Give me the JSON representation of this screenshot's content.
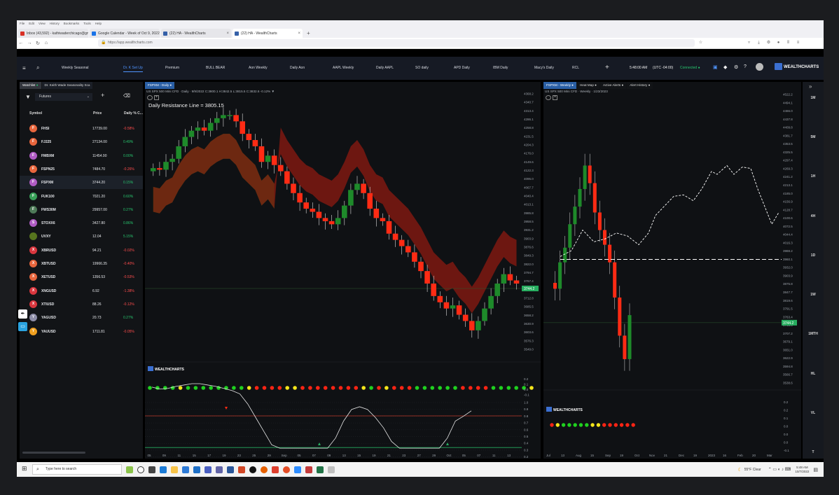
{
  "browser": {
    "menu": [
      "File",
      "Edit",
      "View",
      "History",
      "Bookmarks",
      "Tools",
      "Help"
    ],
    "tabs": [
      {
        "label": "Inbox (43,592) - kathiwaderchicago@gmail.com",
        "fav": "#d93025",
        "active": false
      },
      {
        "label": "Google Calendar - Week of Oct 9, 2022",
        "fav": "#1a73e8",
        "active": false
      },
      {
        "label": "(22) HA - WealthCharts",
        "fav": "#3560a8",
        "active": false
      },
      {
        "label": "(22) HA - WealthCharts",
        "fav": "#3560a8",
        "active": true
      }
    ],
    "url": "https://app.wealthcharts.com"
  },
  "toolbar": {
    "tabs": [
      {
        "label": "Weekly Seasonal",
        "x": 64
      },
      {
        "label": "Dr. K Set Up",
        "x": 152,
        "selected": true
      },
      {
        "label": "Premium",
        "x": 212
      },
      {
        "label": "BULL BEAR",
        "x": 270
      },
      {
        "label": "Aon Weekly",
        "x": 331
      },
      {
        "label": "Daily Aon",
        "x": 390
      },
      {
        "label": "AAPL Weekly",
        "x": 451
      },
      {
        "label": "Daily AAPL",
        "x": 513
      },
      {
        "label": "SO daily",
        "x": 569
      },
      {
        "label": "APD Daily",
        "x": 624
      },
      {
        "label": "IBM Daily",
        "x": 680
      },
      {
        "label": "Macy's Daily",
        "x": 739
      },
      {
        "label": "RCL",
        "x": 793
      }
    ],
    "time": "5:48:00 AM",
    "tz": "(UTC -04:00)",
    "status": "Connected",
    "brand": "WEALTHCHARTS"
  },
  "watchlist": {
    "tabs": [
      "Watchlist",
      "Dr. Keith Wade Seasonality Sca"
    ],
    "list": "Futures",
    "headers": {
      "symbol": "Symbol",
      "price": "Price",
      "change": "Daily % C..."
    },
    "rows": [
      {
        "letter": "F",
        "color": "#e8663d",
        "symbol": "FHSI",
        "price": "17739.00",
        "change": "-0.58%",
        "dir": "dn"
      },
      {
        "letter": "F",
        "color": "#e8663d",
        "symbol": "FJ225",
        "price": "27134.00",
        "change": "0.49%",
        "dir": "up"
      },
      {
        "letter": "F",
        "color": "#b05cc4",
        "symbol": "FMBXM",
        "price": "11454.90",
        "change": "0.00%",
        "dir": "up"
      },
      {
        "letter": "F",
        "color": "#e8663d",
        "symbol": "FSPN25",
        "price": "7484.70",
        "change": "-0.26%",
        "dir": "dn"
      },
      {
        "letter": "F",
        "color": "#b05cc4",
        "symbol": "FSPXM",
        "price": "3744.20",
        "change": "0.15%",
        "dir": "up"
      },
      {
        "letter": "F",
        "color": "#38a058",
        "symbol": "FUK100",
        "price": "7021.20",
        "change": "0.60%",
        "dir": "up"
      },
      {
        "letter": "F",
        "color": "#4e7a58",
        "symbol": "FWS30M",
        "price": "29957.00",
        "change": "0.27%",
        "dir": "up"
      },
      {
        "letter": "S",
        "color": "#b05cc4",
        "symbol": "STOXX6",
        "price": "3427.80",
        "change": "0.86%",
        "dir": "up"
      },
      {
        "letter": "",
        "color": "#56741e",
        "symbol": "UVXY",
        "price": "12.04",
        "change": "5.15%",
        "dir": "up"
      },
      {
        "letter": "X",
        "color": "#d9363e",
        "symbol": "XBRUSD",
        "price": "94.21",
        "change": "-0.02%",
        "dir": "dn"
      },
      {
        "letter": "X",
        "color": "#e8663d",
        "symbol": "XBTUSD",
        "price": "19966.35",
        "change": "-0.40%",
        "dir": "dn"
      },
      {
        "letter": "X",
        "color": "#e8663d",
        "symbol": "XETUSD",
        "price": "1356.53",
        "change": "-0.53%",
        "dir": "dn"
      },
      {
        "letter": "X",
        "color": "#d9363e",
        "symbol": "XNGUSD",
        "price": "6.92",
        "change": "-1.38%",
        "dir": "dn"
      },
      {
        "letter": "X",
        "color": "#d9363e",
        "symbol": "XTIUSD",
        "price": "88.26",
        "change": "-0.12%",
        "dir": "dn"
      },
      {
        "letter": "Y",
        "color": "#8e8ea8",
        "symbol": "YAGUSD",
        "price": "20.73",
        "change": "0.27%",
        "dir": "up"
      },
      {
        "letter": "Y",
        "color": "#f0a020",
        "symbol": "YAUUSD",
        "price": "1711.81",
        "change": "-0.05%",
        "dir": "dn"
      }
    ]
  },
  "daily": {
    "tab": "FSPXM - Daily",
    "symbol_line": "US SPX 500 Mini CFD · Daily · 9/9/2022 C:3800.1 H:3842.5 L:3815.5 C:3832.6 -0.12% ▼",
    "resistance": "Daily Resistance Line = 3805.15",
    "current_price": "3744.2",
    "price_ticks": [
      "4368.2",
      "4340.7",
      "4313.4",
      "4286.1",
      "4258.8",
      "4231.5",
      "4204.3",
      "4176.0",
      "4149.6",
      "4122.3",
      "4095.0",
      "4067.7",
      "4040.4",
      "4013.1",
      "3985.8",
      "3958.5",
      "3931.2",
      "3903.9",
      "3876.6",
      "3849.3",
      "3822.0",
      "3794.7",
      "3767.4",
      "3740.1",
      "3712.8",
      "3685.5",
      "3658.2",
      "3630.9",
      "3603.6",
      "3576.3",
      "3549.0"
    ],
    "osc_ticks": [
      "1.0",
      "0.9",
      "0.8",
      "0.7",
      "0.6",
      "0.5",
      "0.4",
      "0.3",
      "0.2",
      "0.1"
    ],
    "dots_ticks": [
      "0.2",
      "0.1",
      "0.0",
      "-0.1"
    ],
    "x_ticks": [
      "05",
      "09",
      "11",
      "15",
      "17",
      "19",
      "23",
      "25",
      "29",
      "Sep",
      "05",
      "07",
      "09",
      "13",
      "15",
      "19",
      "21",
      "23",
      "27",
      "29",
      "Oct",
      "05",
      "07",
      "11",
      "13"
    ],
    "brand": "WEALTHCHARTS",
    "dots": [
      "g",
      "g",
      "g",
      "g",
      "y",
      "g",
      "g",
      "g",
      "g",
      "g",
      "g",
      "g",
      "g",
      "y",
      "r",
      "r",
      "r",
      "r",
      "y",
      "y",
      "r",
      "r",
      "r",
      "r",
      "r",
      "r",
      "r",
      "r",
      "y",
      "g",
      "r",
      "y",
      "r",
      "r",
      "r",
      "g",
      "g",
      "g",
      "g",
      "g",
      "g",
      "r",
      "r",
      "r",
      "r",
      "g",
      "g",
      "g",
      "g",
      "g",
      "y"
    ]
  },
  "weekly": {
    "tabs": [
      "FSPXM - Weekly",
      "Heat Map",
      "Active Alerts",
      "Alert History"
    ],
    "symbol_line": "US SPX 500 Mini CFD · Weekly · 1/23/2023",
    "current_price": "3744.2",
    "price_ticks": [
      "4522.2",
      "4494.1",
      "4466.0",
      "4437.8",
      "4409.8",
      "4381.7",
      "4353.5",
      "4325.5",
      "4297.4",
      "4269.3",
      "4241.2",
      "4213.1",
      "4185.0",
      "4156.9",
      "4128.7",
      "4100.6",
      "4072.5",
      "4044.4",
      "4016.3",
      "3988.2",
      "3960.1",
      "3932.0",
      "3903.9",
      "3875.8",
      "3847.7",
      "3819.6",
      "3791.5",
      "3763.4",
      "3735.3",
      "3707.2",
      "3679.1",
      "3651.0",
      "3622.9",
      "3594.8",
      "3566.7",
      "3538.6"
    ],
    "osc_ticks": [
      "0.2",
      "0.2",
      "0.1",
      "0.0",
      "0.0",
      "0.0",
      "-0.1"
    ],
    "x_ticks": [
      "Jul",
      "13",
      "Aug",
      "15",
      "Sep",
      "19",
      "Oct",
      "Nov",
      "21",
      "Dec",
      "19",
      "2023",
      "16",
      "Feb",
      "20",
      "Mar"
    ],
    "brand": "WEALTHCHARTS",
    "dots": [
      "r",
      "y",
      "g",
      "g",
      "g",
      "g",
      "g",
      "y",
      "y",
      "r",
      "r",
      "r",
      "r",
      "r",
      "r"
    ]
  },
  "intervals": [
    "1M",
    "5M",
    "1H",
    "4H",
    "1D",
    "1W",
    "1MTH",
    "HL",
    "VL",
    "T"
  ],
  "taskbar": {
    "search": "Type here to search",
    "weather": "55°F  Clear",
    "clock": "5:48 AM",
    "date": "10/7/2022"
  }
}
